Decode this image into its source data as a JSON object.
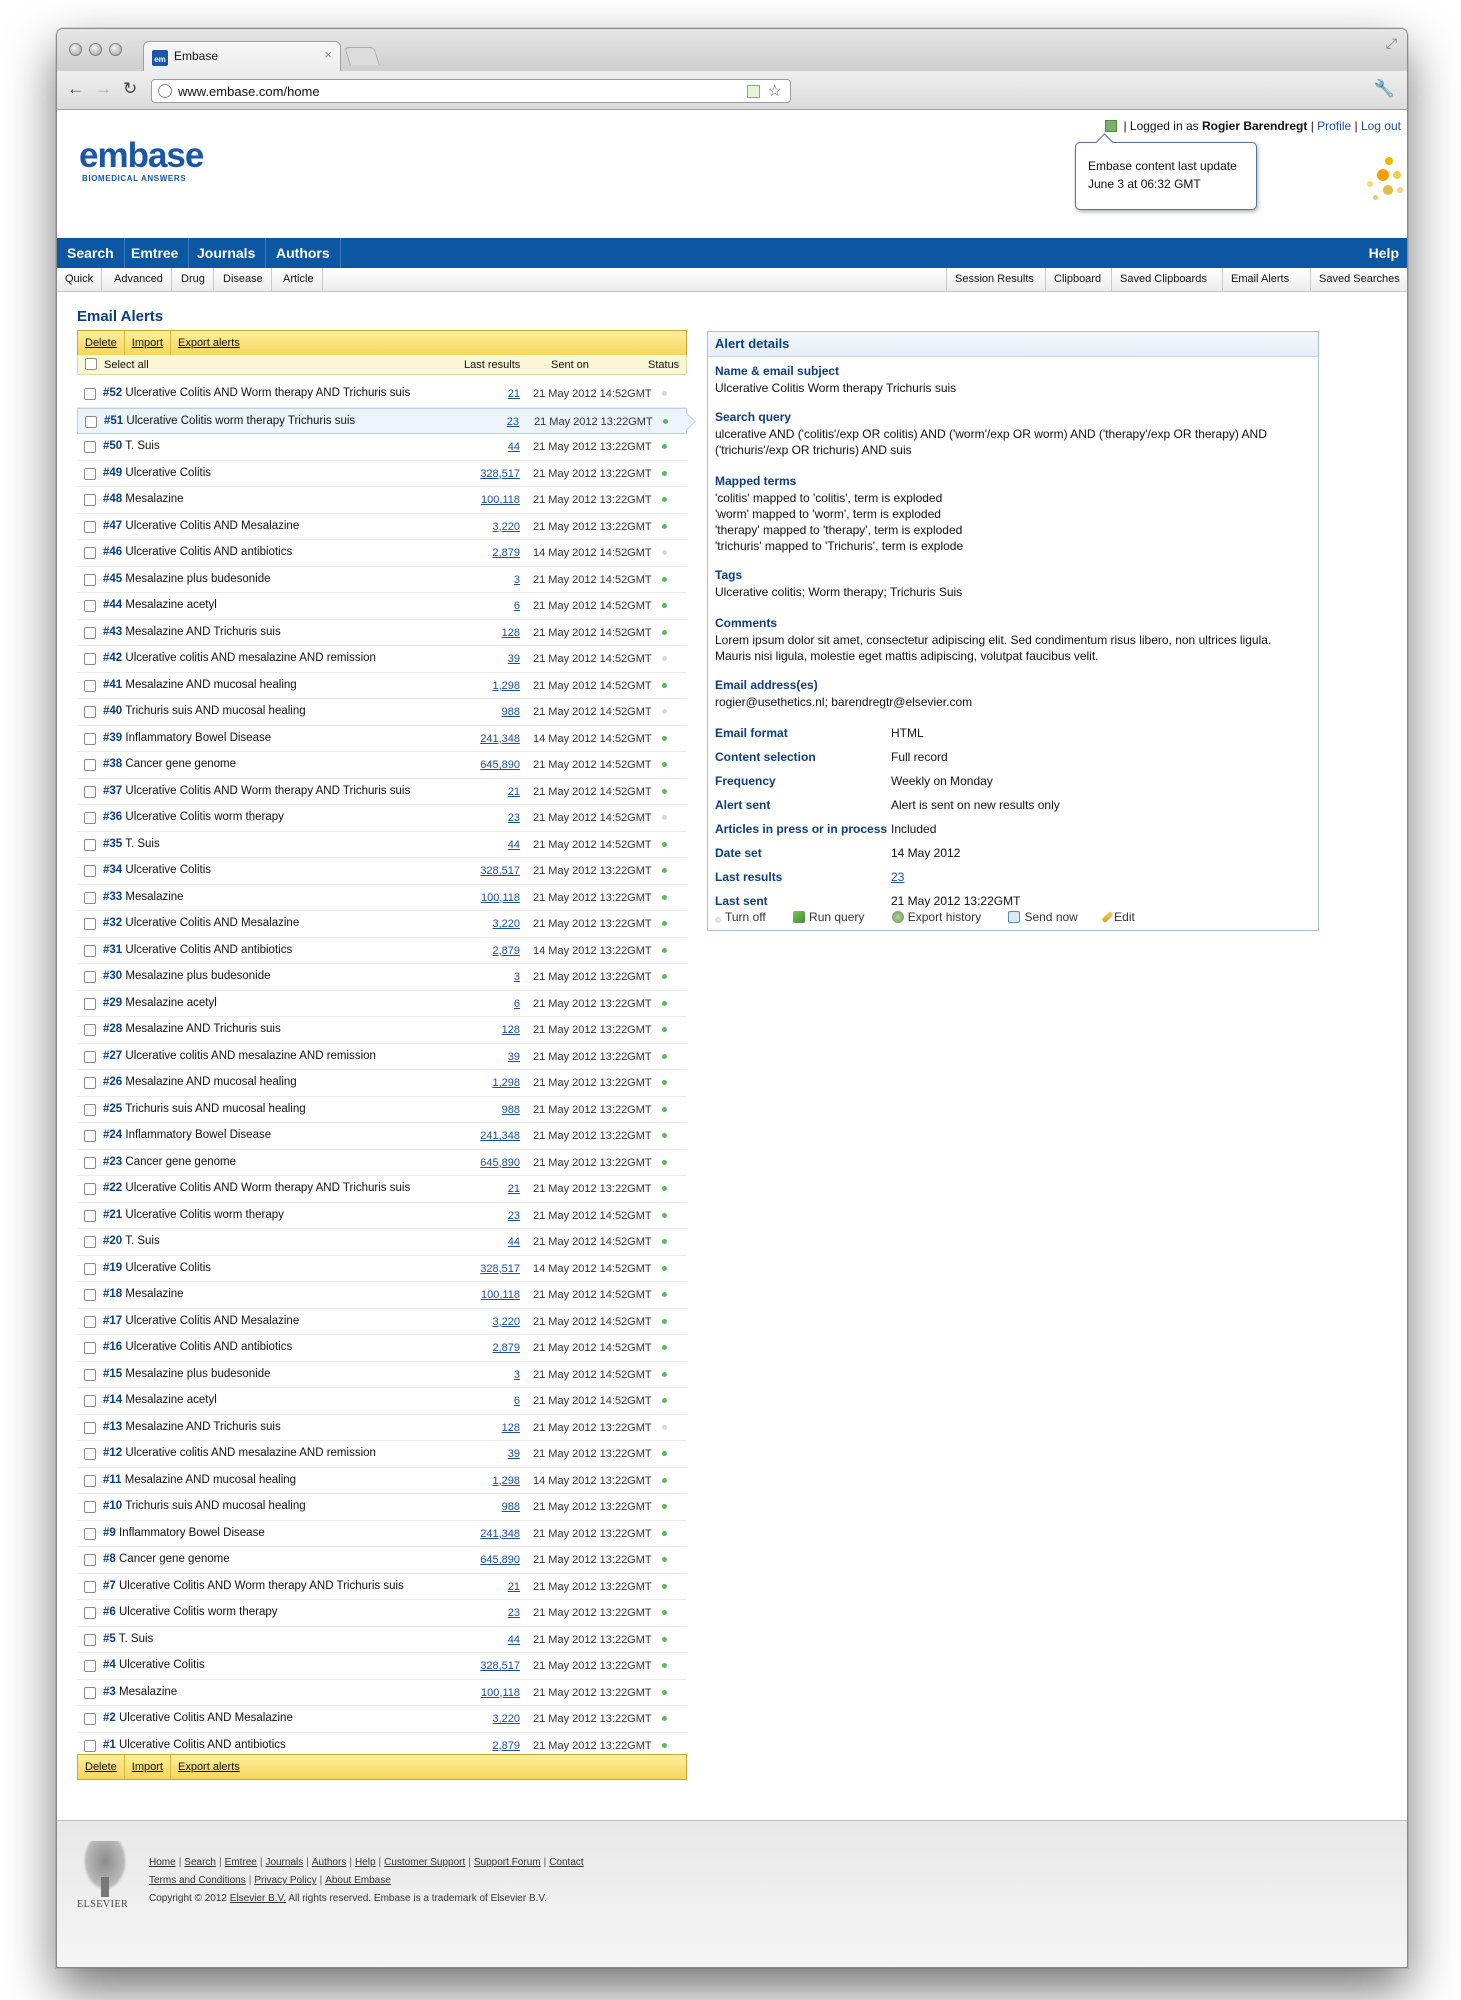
{
  "browser": {
    "tab_title": "Embase",
    "tab_favicon": "em",
    "url": "www.embase.com/home"
  },
  "header": {
    "logo_word": "embase",
    "logo_sub": "BIOMEDICAL ANSWERS",
    "logged_in_prefix": "Logged in as",
    "user_name": "Rogier Barendregt",
    "profile_link": "Profile",
    "logout_link": "Log out",
    "tooltip_line1": "Embase content last update",
    "tooltip_line2": "June 3 at 06:32 GMT"
  },
  "mainnav": {
    "items": [
      "Search",
      "Emtree",
      "Journals",
      "Authors"
    ],
    "help": "Help"
  },
  "subnav": {
    "left": [
      "Quick",
      "Advanced",
      "Drug",
      "Disease",
      "Article"
    ],
    "right": [
      "Session Results",
      "Clipboard",
      "Saved Clipboards",
      "Email Alerts",
      "Saved Searches"
    ]
  },
  "page_title": "Email Alerts",
  "actions": {
    "delete": "Delete",
    "import": "Import",
    "export": "Export alerts"
  },
  "table_header": {
    "select_all": "Select all",
    "last_results": "Last results",
    "sent_on": "Sent on",
    "status": "Status"
  },
  "status_colors": {
    "active": "#5cb85c",
    "inactive": "#d9d9d9"
  },
  "alerts": [
    {
      "num": "#52",
      "name": "Ulcerative Colitis AND Worm therapy AND Trichuris suis",
      "count": "21",
      "date": "21 May 2012 14:52GMT",
      "active": false
    },
    {
      "num": "#51",
      "name": "Ulcerative Colitis worm therapy Trichuris suis",
      "count": "23",
      "date": "21 May 2012 13:22GMT",
      "active": true,
      "selected": true
    },
    {
      "num": "#50",
      "name": "T. Suis",
      "count": "44",
      "date": "21 May 2012 13:22GMT",
      "active": true
    },
    {
      "num": "#49",
      "name": "Ulcerative Colitis",
      "count": "328,517",
      "date": "21 May 2012 13:22GMT",
      "active": true
    },
    {
      "num": "#48",
      "name": "Mesalazine",
      "count": "100,118",
      "date": "21 May 2012 13:22GMT",
      "active": true
    },
    {
      "num": "#47",
      "name": "Ulcerative Colitis AND Mesalazine",
      "count": "3,220",
      "date": "21 May 2012 13:22GMT",
      "active": true
    },
    {
      "num": "#46",
      "name": "Ulcerative Colitis AND antibiotics",
      "count": "2,879",
      "date": "14 May 2012 14:52GMT",
      "active": false
    },
    {
      "num": "#45",
      "name": "Mesalazine plus budesonide",
      "count": "3",
      "date": "21 May 2012 14:52GMT",
      "active": true
    },
    {
      "num": "#44",
      "name": "Mesalazine acetyl",
      "count": "6",
      "date": "21 May 2012 14:52GMT",
      "active": true
    },
    {
      "num": "#43",
      "name": "Mesalazine AND Trichuris suis",
      "count": "128",
      "date": "21 May 2012 14:52GMT",
      "active": true
    },
    {
      "num": "#42",
      "name": "Ulcerative colitis AND mesalazine AND remission",
      "count": "39",
      "date": "21 May 2012 14:52GMT",
      "active": false
    },
    {
      "num": "#41",
      "name": "Mesalazine AND mucosal healing",
      "count": "1,298",
      "date": "21 May 2012 14:52GMT",
      "active": true
    },
    {
      "num": "#40",
      "name": "Trichuris suis AND mucosal healing",
      "count": "988",
      "date": "21 May 2012 14:52GMT",
      "active": false
    },
    {
      "num": "#39",
      "name": "Inflammatory Bowel Disease",
      "count": "241,348",
      "date": "14 May 2012 14:52GMT",
      "active": true
    },
    {
      "num": "#38",
      "name": "Cancer gene genome",
      "count": "645,890",
      "date": "21 May 2012 14:52GMT",
      "active": true
    },
    {
      "num": "#37",
      "name": "Ulcerative Colitis AND Worm therapy AND Trichuris suis",
      "count": "21",
      "date": "21 May 2012 14:52GMT",
      "active": true
    },
    {
      "num": "#36",
      "name": "Ulcerative Colitis worm therapy",
      "count": "23",
      "date": "21 May 2012 14:52GMT",
      "active": false
    },
    {
      "num": "#35",
      "name": "T. Suis",
      "count": "44",
      "date": "21 May 2012 14:52GMT",
      "active": true
    },
    {
      "num": "#34",
      "name": "Ulcerative Colitis",
      "count": "328,517",
      "date": "21 May 2012 13:22GMT",
      "active": true
    },
    {
      "num": "#33",
      "name": "Mesalazine",
      "count": "100,118",
      "date": "21 May 2012 13:22GMT",
      "active": true
    },
    {
      "num": "#32",
      "name": "Ulcerative Colitis AND Mesalazine",
      "count": "3,220",
      "date": "21 May 2012 13:22GMT",
      "active": true
    },
    {
      "num": "#31",
      "name": "Ulcerative Colitis AND antibiotics",
      "count": "2,879",
      "date": "14 May 2012 13:22GMT",
      "active": true
    },
    {
      "num": "#30",
      "name": "Mesalazine plus budesonide",
      "count": "3",
      "date": "21 May 2012 13:22GMT",
      "active": true
    },
    {
      "num": "#29",
      "name": "Mesalazine acetyl",
      "count": "6",
      "date": "21 May 2012 13:22GMT",
      "active": true
    },
    {
      "num": "#28",
      "name": "Mesalazine AND Trichuris suis",
      "count": "128",
      "date": "21 May 2012 13:22GMT",
      "active": true
    },
    {
      "num": "#27",
      "name": "Ulcerative colitis AND mesalazine AND remission",
      "count": "39",
      "date": "21 May 2012 13:22GMT",
      "active": true
    },
    {
      "num": "#26",
      "name": "Mesalazine AND mucosal healing",
      "count": "1,298",
      "date": "21 May 2012 13:22GMT",
      "active": true
    },
    {
      "num": "#25",
      "name": "Trichuris suis AND mucosal healing",
      "count": "988",
      "date": "21 May 2012 13:22GMT",
      "active": true
    },
    {
      "num": "#24",
      "name": "Inflammatory Bowel Disease",
      "count": "241,348",
      "date": "21 May 2012 13:22GMT",
      "active": true
    },
    {
      "num": "#23",
      "name": "Cancer gene genome",
      "count": "645,890",
      "date": "21 May 2012 13:22GMT",
      "active": true
    },
    {
      "num": "#22",
      "name": "Ulcerative Colitis AND Worm therapy AND Trichuris suis",
      "count": "21",
      "date": "21 May 2012 13:22GMT",
      "active": true
    },
    {
      "num": "#21",
      "name": "Ulcerative Colitis worm therapy",
      "count": "23",
      "date": "21 May 2012 14:52GMT",
      "active": true
    },
    {
      "num": "#20",
      "name": "T. Suis",
      "count": "44",
      "date": "21 May 2012 14:52GMT",
      "active": true
    },
    {
      "num": "#19",
      "name": "Ulcerative Colitis",
      "count": "328,517",
      "date": "14 May 2012 14:52GMT",
      "active": true
    },
    {
      "num": "#18",
      "name": "Mesalazine",
      "count": "100,118",
      "date": "21 May 2012 14:52GMT",
      "active": true
    },
    {
      "num": "#17",
      "name": "Ulcerative Colitis AND Mesalazine",
      "count": "3,220",
      "date": "21 May 2012 14:52GMT",
      "active": true
    },
    {
      "num": "#16",
      "name": "Ulcerative Colitis AND antibiotics",
      "count": "2,879",
      "date": "21 May 2012 14:52GMT",
      "active": true
    },
    {
      "num": "#15",
      "name": "Mesalazine plus budesonide",
      "count": "3",
      "date": "21 May 2012 14:52GMT",
      "active": true
    },
    {
      "num": "#14",
      "name": "Mesalazine acetyl",
      "count": "6",
      "date": "21 May 2012 14:52GMT",
      "active": true
    },
    {
      "num": "#13",
      "name": "Mesalazine AND Trichuris suis",
      "count": "128",
      "date": "21 May 2012 13:22GMT",
      "active": false
    },
    {
      "num": "#12",
      "name": "Ulcerative colitis AND mesalazine AND remission",
      "count": "39",
      "date": "21 May 2012 13:22GMT",
      "active": true
    },
    {
      "num": "#11",
      "name": "Mesalazine AND mucosal healing",
      "count": "1,298",
      "date": "14 May 2012 13:22GMT",
      "active": true
    },
    {
      "num": "#10",
      "name": "Trichuris suis AND mucosal healing",
      "count": "988",
      "date": "21 May 2012 13:22GMT",
      "active": true
    },
    {
      "num": "#9",
      "name": "Inflammatory Bowel Disease",
      "count": "241,348",
      "date": "21 May 2012 13:22GMT",
      "active": true
    },
    {
      "num": "#8",
      "name": "Cancer gene genome",
      "count": "645,890",
      "date": "21 May 2012 13:22GMT",
      "active": true
    },
    {
      "num": "#7",
      "name": "Ulcerative Colitis AND Worm therapy AND Trichuris suis",
      "count": "21",
      "date": "21 May 2012 13:22GMT",
      "active": true
    },
    {
      "num": "#6",
      "name": "Ulcerative Colitis worm therapy",
      "count": "23",
      "date": "21 May 2012 13:22GMT",
      "active": true
    },
    {
      "num": "#5",
      "name": "T. Suis",
      "count": "44",
      "date": "21 May 2012 13:22GMT",
      "active": true
    },
    {
      "num": "#4",
      "name": "Ulcerative Colitis",
      "count": "328,517",
      "date": "21 May 2012 13:22GMT",
      "active": true
    },
    {
      "num": "#3",
      "name": "Mesalazine",
      "count": "100,118",
      "date": "21 May 2012 13:22GMT",
      "active": true
    },
    {
      "num": "#2",
      "name": "Ulcerative Colitis AND Mesalazine",
      "count": "3,220",
      "date": "21 May 2012 13:22GMT",
      "active": true
    },
    {
      "num": "#1",
      "name": "Ulcerative Colitis AND antibiotics",
      "count": "2,879",
      "date": "21 May 2012 13:22GMT",
      "active": true
    }
  ],
  "details": {
    "title": "Alert details",
    "name_label": "Name & email subject",
    "name_value": "Ulcerative Colitis Worm therapy Trichuris suis",
    "query_label": "Search query",
    "query_value": "ulcerative AND ('colitis'/exp OR colitis) AND ('worm'/exp OR worm) AND ('therapy'/exp OR therapy) AND ('trichuris'/exp OR trichuris) AND suis",
    "mapped_label": "Mapped terms",
    "mapped_lines": [
      "'colitis' mapped to 'colitis', term is exploded",
      "'worm' mapped to 'worm', term is exploded",
      "'therapy' mapped to 'therapy', term is exploded",
      "'trichuris' mapped to 'Trichuris', term is explode"
    ],
    "tags_label": "Tags",
    "tags_value": "Ulcerative colitis; Worm therapy; Trichuris Suis",
    "comments_label": "Comments",
    "comments_value": "Lorem ipsum dolor sit amet, consectetur adipiscing elit. Sed condimentum risus libero, non ultrices ligula. Mauris nisi ligula, molestie eget mattis adipiscing, volutpat faucibus velit.",
    "email_label": "Email address(es)",
    "email_value": "rogier@usethetics.nl; barendregtr@elsevier.com",
    "fields": [
      {
        "label": "Email format",
        "value": "HTML"
      },
      {
        "label": "Content selection",
        "value": "Full record"
      },
      {
        "label": "Frequency",
        "value": "Weekly on Monday"
      },
      {
        "label": "Alert sent",
        "value": "Alert is sent on new results only"
      },
      {
        "label": "Articles in press or in process",
        "value": "Included"
      },
      {
        "label": "Date set",
        "value": "14 May 2012"
      },
      {
        "label": "Last results",
        "value": "23",
        "link": true
      },
      {
        "label": "Last sent",
        "value": "21 May 2012 13:22GMT"
      }
    ],
    "actions": {
      "turn_off": "Turn off",
      "run_query": "Run query",
      "export_history": "Export history",
      "send_now": "Send now",
      "edit": "Edit"
    }
  },
  "footer": {
    "logo_word": "ELSEVIER",
    "links_line1": [
      "Home",
      "Search",
      "Emtree",
      "Journals",
      "Authors",
      "Help",
      "Customer Support",
      "Support Forum",
      "Contact"
    ],
    "links_line2": [
      "Terms and Conditions",
      "Privacy Policy",
      "About Embase"
    ],
    "copyright_prefix": "Copyright © 2012",
    "copyright_link": "Elsevier B.V.",
    "copyright_suffix": "All rights reserved. Embase is a trademark of Elsevier B.V."
  }
}
